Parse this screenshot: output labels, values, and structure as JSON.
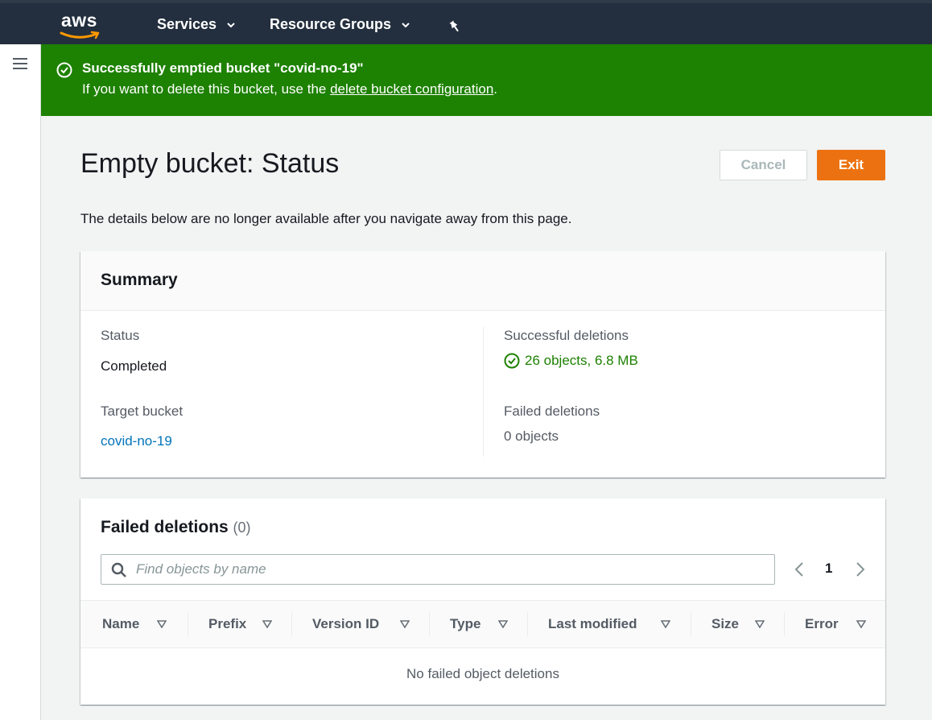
{
  "topbar": {
    "logo_text": "aws",
    "nav": [
      {
        "label": "Services"
      },
      {
        "label": "Resource Groups"
      }
    ]
  },
  "flash": {
    "title": "Successfully emptied bucket \"covid-no-19\"",
    "body_prefix": "If you want to delete this bucket, use the ",
    "body_link": "delete bucket configuration",
    "body_suffix": ".",
    "color": "#1d8102"
  },
  "header": {
    "title": "Empty bucket: Status",
    "cancel_label": "Cancel",
    "exit_label": "Exit",
    "intro": "The details below are no longer available after you navigate away from this page."
  },
  "summary": {
    "heading": "Summary",
    "status_label": "Status",
    "status_value": "Completed",
    "target_label": "Target bucket",
    "target_value": "covid-no-19",
    "success_label": "Successful deletions",
    "success_value": "26 objects, 6.8 MB",
    "failed_label": "Failed deletions",
    "failed_value": "0 objects"
  },
  "failed": {
    "heading": "Failed deletions",
    "count": "(0)",
    "search_placeholder": "Find objects by name",
    "page": "1",
    "columns": [
      "Name",
      "Prefix",
      "Version ID",
      "Type",
      "Last modified",
      "Size",
      "Error"
    ],
    "empty_message": "No failed object deletions"
  },
  "colors": {
    "accent": "#ec7211",
    "topbar": "#232f3e",
    "success": "#1d8102",
    "link": "#0073bb"
  }
}
